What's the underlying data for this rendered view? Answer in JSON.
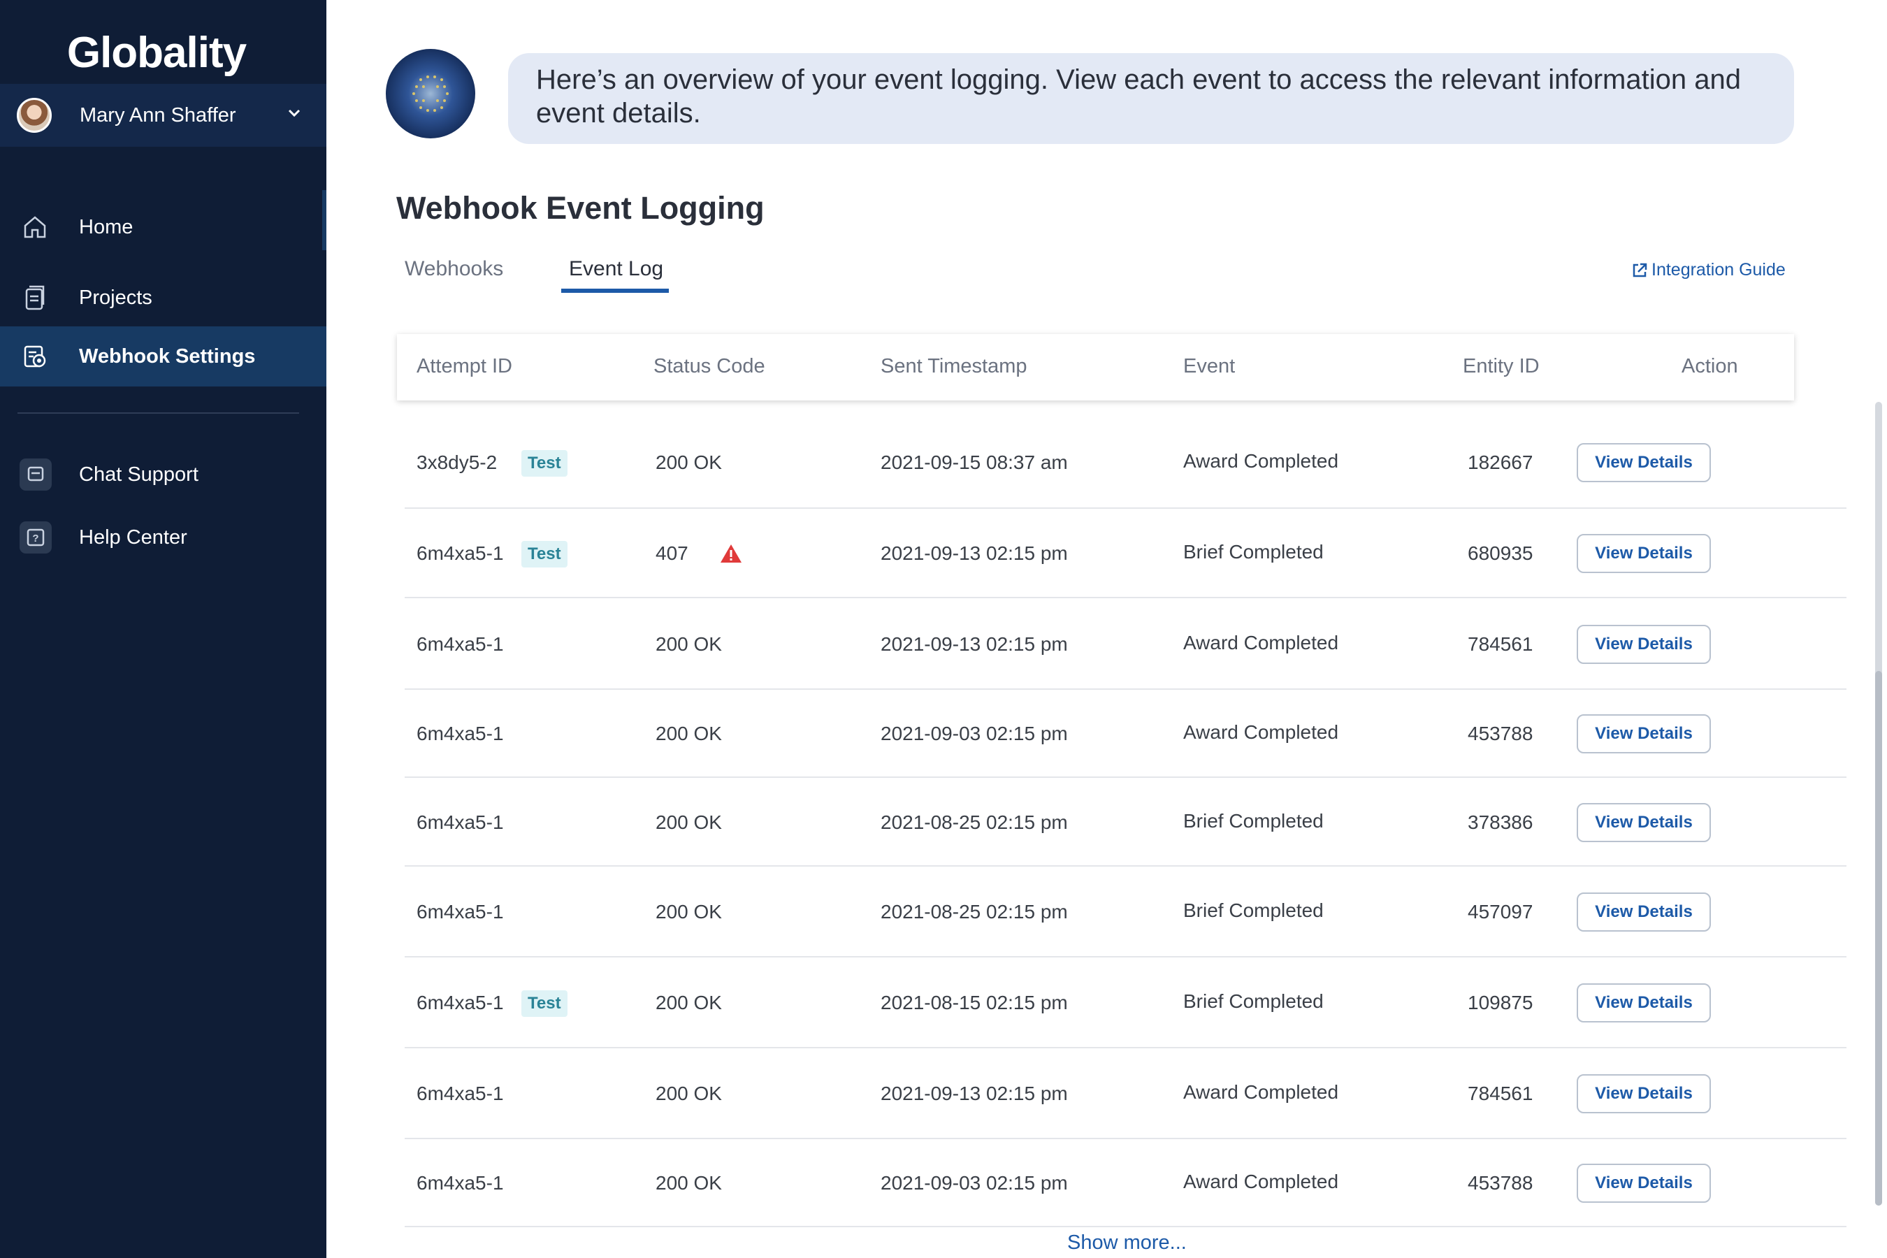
{
  "sidebar": {
    "logo": "Globality",
    "user_name": "Mary Ann Shaffer",
    "nav": [
      {
        "label": "Home",
        "icon": "home-icon"
      },
      {
        "label": "Projects",
        "icon": "projects-icon"
      },
      {
        "label": "Webhook Settings",
        "icon": "webhook-settings-icon",
        "active": true
      }
    ],
    "support": [
      {
        "label": "Chat Support",
        "icon": "chat-support-icon"
      },
      {
        "label": "Help Center",
        "icon": "help-center-icon"
      }
    ]
  },
  "assistant": {
    "message": "Here’s an overview of your event logging. View each event to access the relevant information and event details."
  },
  "page": {
    "title": "Webhook Event Logging",
    "tabs": [
      {
        "label": "Webhooks",
        "active": false
      },
      {
        "label": "Event Log",
        "active": true
      }
    ],
    "integration_guide": "Integration Guide"
  },
  "table": {
    "columns": [
      "Attempt ID",
      "Status Code",
      "Sent Timestamp",
      "Event",
      "Entity ID",
      "Action"
    ],
    "rows": [
      {
        "attempt_id": "3x8dy5-2",
        "test": "Test",
        "status": "200 OK",
        "warning": false,
        "timestamp": "2021-09-15 08:37 am",
        "event": "Award Completed",
        "entity_id": "182667",
        "action": "View Details"
      },
      {
        "attempt_id": "6m4xa5-1",
        "test": "Test",
        "status": "407",
        "warning": true,
        "timestamp": "2021-09-13 02:15 pm",
        "event": "Brief Completed",
        "entity_id": "680935",
        "action": "View Details"
      },
      {
        "attempt_id": "6m4xa5-1",
        "test": "",
        "status": "200 OK",
        "warning": false,
        "timestamp": "2021-09-13 02:15 pm",
        "event": "Award Completed",
        "entity_id": "784561",
        "action": "View Details"
      },
      {
        "attempt_id": "6m4xa5-1",
        "test": "",
        "status": "200 OK",
        "warning": false,
        "timestamp": "2021-09-03 02:15 pm",
        "event": "Award Completed",
        "entity_id": "453788",
        "action": "View Details"
      },
      {
        "attempt_id": "6m4xa5-1",
        "test": "",
        "status": "200 OK",
        "warning": false,
        "timestamp": "2021-08-25 02:15 pm",
        "event": "Brief Completed",
        "entity_id": "378386",
        "action": "View Details"
      },
      {
        "attempt_id": "6m4xa5-1",
        "test": "",
        "status": "200 OK",
        "warning": false,
        "timestamp": "2021-08-25 02:15 pm",
        "event": "Brief Completed",
        "entity_id": "457097",
        "action": "View Details"
      },
      {
        "attempt_id": "6m4xa5-1",
        "test": "Test",
        "status": "200 OK",
        "warning": false,
        "timestamp": "2021-08-15 02:15 pm",
        "event": "Brief Completed",
        "entity_id": "109875",
        "action": "View Details"
      },
      {
        "attempt_id": "6m4xa5-1",
        "test": "",
        "status": "200 OK",
        "warning": false,
        "timestamp": "2021-09-13 02:15 pm",
        "event": "Award Completed",
        "entity_id": "784561",
        "action": "View Details"
      },
      {
        "attempt_id": "6m4xa5-1",
        "test": "",
        "status": "200 OK",
        "warning": false,
        "timestamp": "2021-09-03 02:15 pm",
        "event": "Award Completed",
        "entity_id": "453788",
        "action": "View Details"
      }
    ],
    "show_more": "Show more..."
  },
  "colors": {
    "sidebar_bg": "#0f1d36",
    "active_nav": "#173a63",
    "accent": "#1d5aa8",
    "badge_bg": "#dff3f6",
    "warning": "#e03a3a"
  }
}
